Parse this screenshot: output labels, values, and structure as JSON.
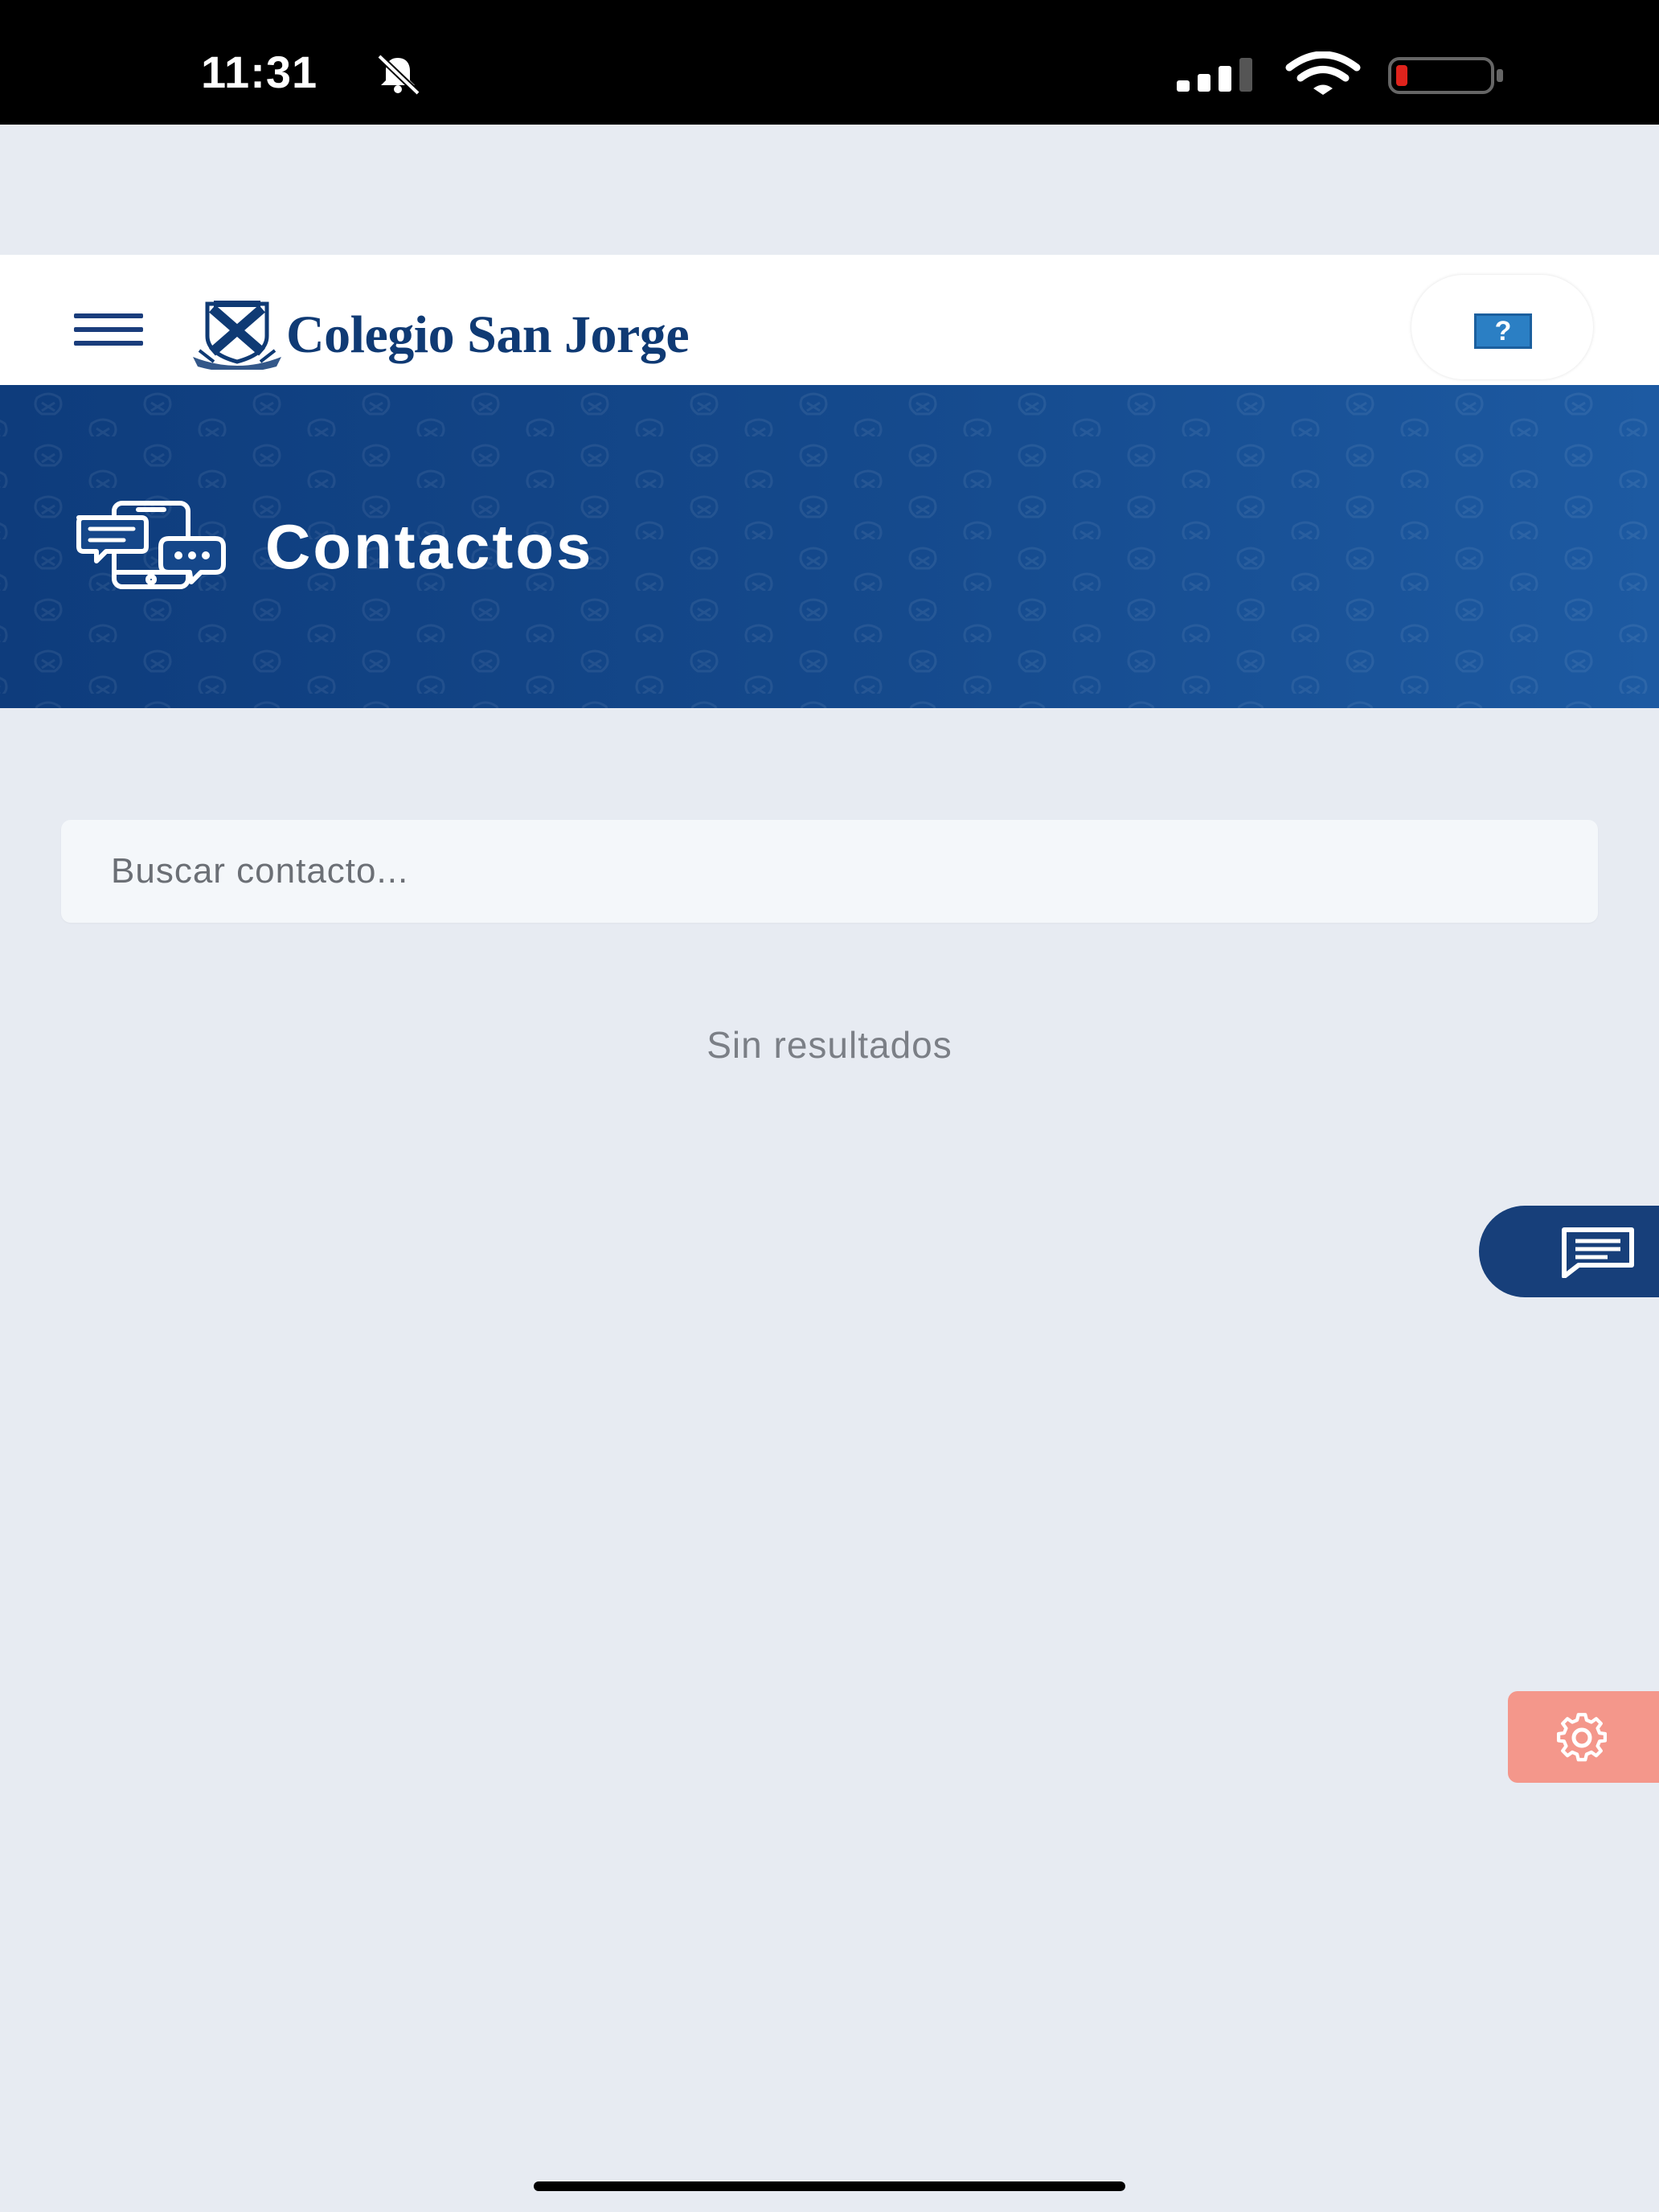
{
  "status_bar": {
    "time": "11:31"
  },
  "header": {
    "logo_text": "Colegio San Jorge",
    "help_label": "?"
  },
  "banner": {
    "title": "Contactos"
  },
  "search": {
    "placeholder": "Buscar contacto...",
    "value": ""
  },
  "results": {
    "empty_text": "Sin resultados"
  },
  "colors": {
    "primary_blue": "#0f3a74",
    "banner_blue": "#154a8d",
    "background": "#e7ebf2",
    "settings_accent": "#f4978b"
  },
  "icons": {
    "status": [
      "bell-slash-icon",
      "signal-icon",
      "wifi-icon",
      "battery-low-icon"
    ],
    "header": [
      "hamburger-menu-icon",
      "school-crest-icon",
      "help-icon"
    ],
    "banner": "phone-chat-icon",
    "floating": [
      "chat-message-icon",
      "gear-icon"
    ]
  }
}
